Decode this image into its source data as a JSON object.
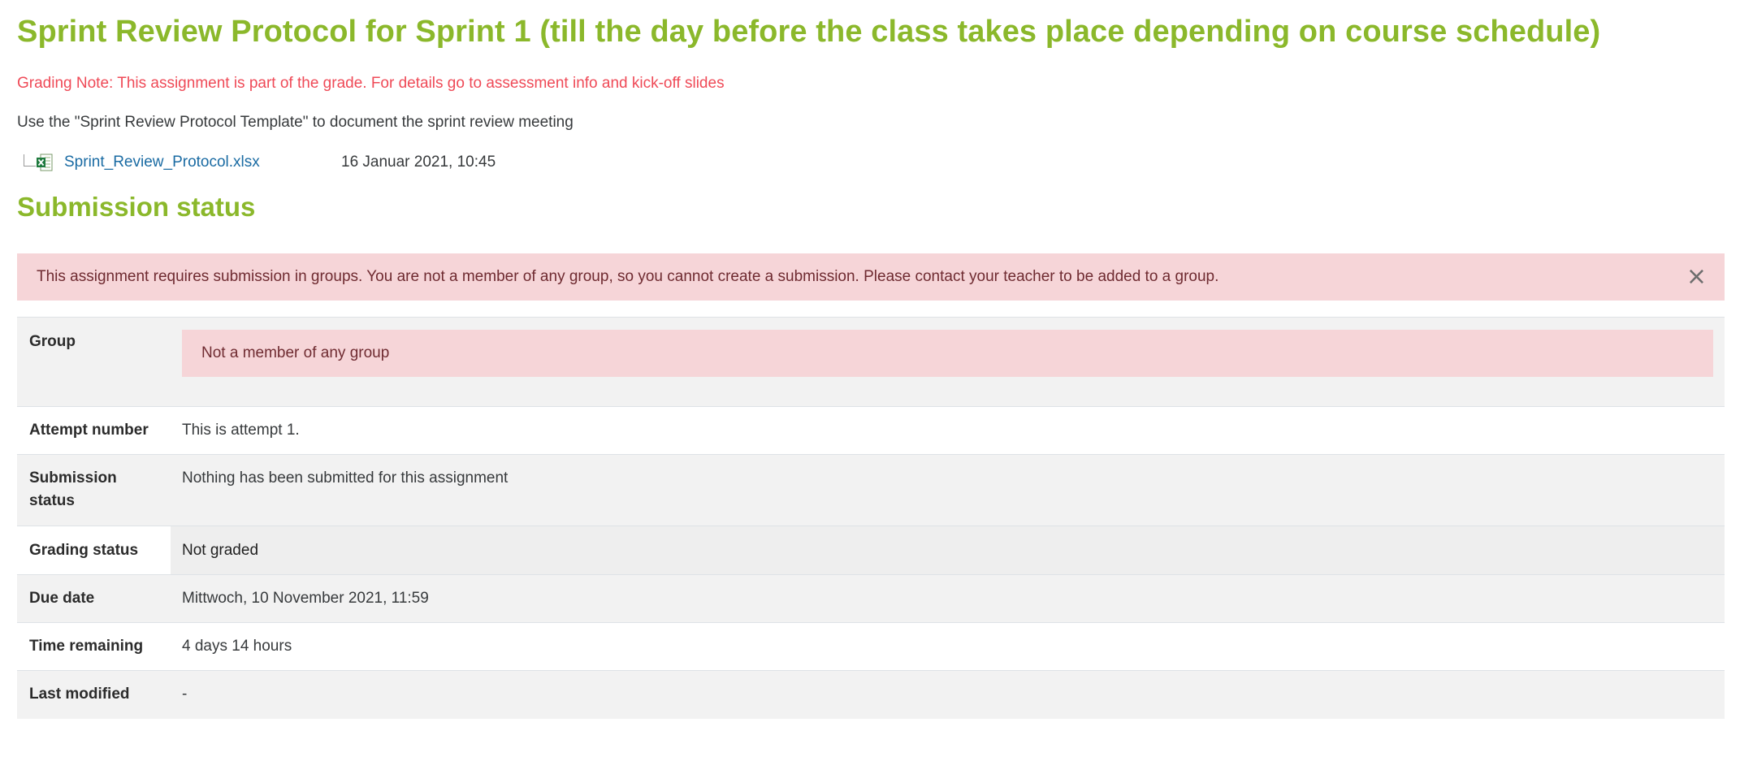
{
  "assignment": {
    "title": "Sprint Review Protocol for Sprint 1 (till the day before the class takes place depending on course schedule)",
    "grading_note": "Grading Note: This assignment is part of the grade. For details go to assessment info and kick-off slides",
    "intro": "Use the \"Sprint Review Protocol Template\" to document the sprint review meeting",
    "file": {
      "name": "Sprint_Review_Protocol.xlsx",
      "date": "16 Januar 2021, 10:45",
      "icon": "xlsx-file-icon"
    }
  },
  "submission": {
    "section_title": "Submission status",
    "alert_text": "This assignment requires submission in groups. You are not a member of any group, so you cannot create a submission. Please contact your teacher to be added to a group.",
    "alert_close_icon": "×",
    "rows": {
      "group": {
        "label": "Group",
        "value": "Not a member of any group"
      },
      "attempt": {
        "label": "Attempt number",
        "value": "This is attempt 1."
      },
      "submission_status": {
        "label": "Submission status",
        "value": "Nothing has been submitted for this assignment"
      },
      "grading_status": {
        "label": "Grading status",
        "value": "Not graded"
      },
      "due_date": {
        "label": "Due date",
        "value": "Mittwoch, 10 November 2021, 11:59"
      },
      "time_remaining": {
        "label": "Time remaining",
        "value": "4 days 14 hours"
      },
      "last_modified": {
        "label": "Last modified",
        "value": "-"
      }
    }
  },
  "colors": {
    "heading": "#8bb82b",
    "grading_note": "#ef4a57",
    "link": "#1a6ba3",
    "alert_bg": "#f6d5d8",
    "alert_text": "#6f2b31",
    "row_shade": "#f2f2f2"
  }
}
